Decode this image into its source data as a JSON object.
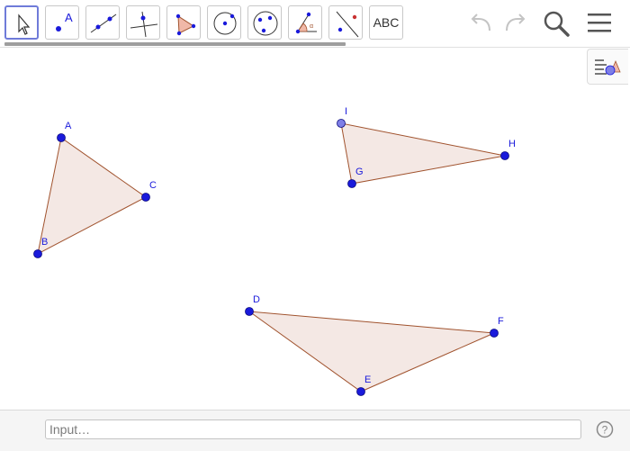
{
  "toolbar": {
    "tools": [
      {
        "name": "move-tool",
        "icon": "arrow-cursor-icon"
      },
      {
        "name": "point-tool",
        "icon": "point-icon",
        "label": "A"
      },
      {
        "name": "line-tool",
        "icon": "line-icon"
      },
      {
        "name": "perpendicular-line-tool",
        "icon": "perpendicular-icon"
      },
      {
        "name": "polygon-tool",
        "icon": "polygon-icon"
      },
      {
        "name": "circle-tool",
        "icon": "circle-icon"
      },
      {
        "name": "conic-tool",
        "icon": "ellipse-icon"
      },
      {
        "name": "angle-tool",
        "icon": "angle-icon",
        "label": "α"
      },
      {
        "name": "reflect-tool",
        "icon": "reflect-icon"
      },
      {
        "name": "text-tool",
        "icon": "text-icon",
        "label": "ABC"
      }
    ],
    "selected_tool": "move-tool",
    "undo_icon": "undo-icon",
    "redo_icon": "redo-icon",
    "search_icon": "search-icon",
    "menu_icon": "hamburger-menu-icon"
  },
  "style_bar_toggle": {
    "icon": "style-bar-icon"
  },
  "canvas": {
    "colors": {
      "point": "#1a1adb",
      "point_free": "#7f7fe6",
      "polygon_fill": "#f4e8e4",
      "polygon_edge": "#a0522d"
    },
    "points": {
      "A": {
        "label": "A"
      },
      "B": {
        "label": "B"
      },
      "C": {
        "label": "C"
      },
      "D": {
        "label": "D"
      },
      "E": {
        "label": "E"
      },
      "F": {
        "label": "F"
      },
      "G": {
        "label": "G"
      },
      "H": {
        "label": "H"
      },
      "I": {
        "label": "I"
      }
    },
    "polygons": [
      {
        "name": "triangle-abc",
        "vertices": [
          "A",
          "B",
          "C"
        ]
      },
      {
        "name": "triangle-def",
        "vertices": [
          "D",
          "E",
          "F"
        ]
      },
      {
        "name": "triangle-igh",
        "vertices": [
          "I",
          "G",
          "H"
        ]
      }
    ]
  },
  "input_bar": {
    "placeholder": "Input…",
    "help_icon": "help-icon"
  }
}
